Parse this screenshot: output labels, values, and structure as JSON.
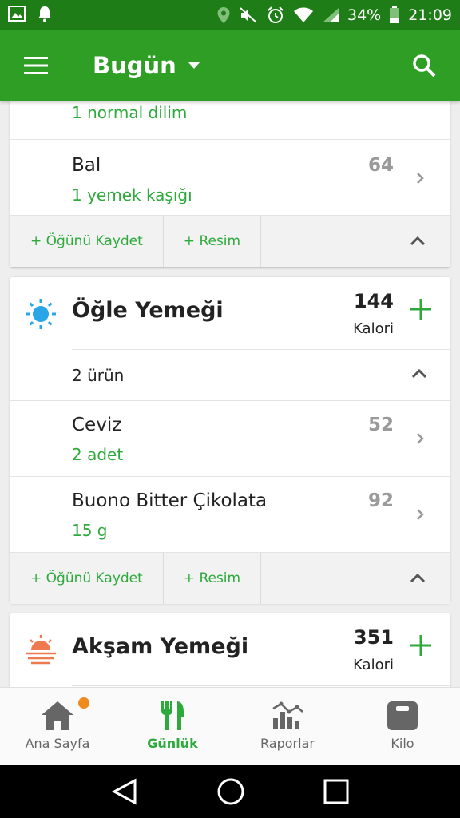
{
  "status_bar": {
    "battery": "34%",
    "time": "21:09"
  },
  "app_bar": {
    "title": "Bugün"
  },
  "top_card": {
    "partial_amount": "1 normal dilim",
    "items": [
      {
        "name": "Bal",
        "amount": "1 yemek kaşığı",
        "calories": "64"
      }
    ],
    "actions": {
      "save_meal": "+ Öğünü Kaydet",
      "photo": "+ Resim"
    }
  },
  "lunch": {
    "title": "Öğle Yemeği",
    "calories": "144",
    "calories_label": "Kalori",
    "item_count": "2 ürün",
    "items": [
      {
        "name": "Ceviz",
        "amount": "2 adet",
        "calories": "52"
      },
      {
        "name": "Buono Bitter Çikolata",
        "amount": "15 g",
        "calories": "92"
      }
    ],
    "actions": {
      "save_meal": "+ Öğünü Kaydet",
      "photo": "+ Resim"
    }
  },
  "dinner": {
    "title": "Akşam Yemeği",
    "calories": "351",
    "calories_label": "Kalori"
  },
  "bottom_nav": [
    {
      "label": "Ana Sayfa",
      "icon": "home-icon"
    },
    {
      "label": "Günlük",
      "icon": "fork-knife-icon",
      "active": true
    },
    {
      "label": "Raporlar",
      "icon": "chart-icon"
    },
    {
      "label": "Kilo",
      "icon": "scale-icon"
    }
  ],
  "colors": {
    "primary": "#2e9e25",
    "status_bar": "#1e7d16",
    "accent_green": "#2eaa3c",
    "lunch_icon": "#29a6e8",
    "dinner_icon": "#f07a50"
  }
}
